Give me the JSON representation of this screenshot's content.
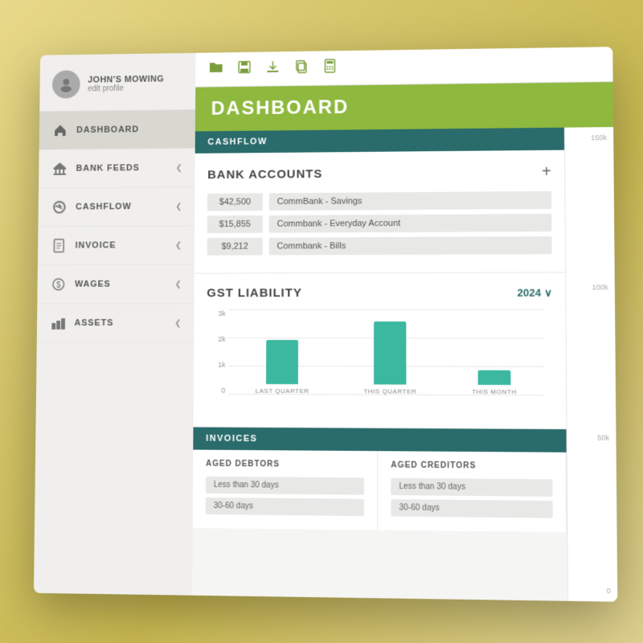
{
  "sidebar": {
    "company": "JOHN'S MOWING",
    "edit_profile": "edit profile",
    "nav_items": [
      {
        "id": "dashboard",
        "label": "DASHBOARD",
        "icon": "🏠",
        "active": true,
        "arrow": ""
      },
      {
        "id": "bank-feeds",
        "label": "BANK FEEDS",
        "icon": "🏛",
        "active": false,
        "arrow": "❮"
      },
      {
        "id": "cashflow",
        "label": "CASHFLOW",
        "icon": "↻",
        "active": false,
        "arrow": "❮"
      },
      {
        "id": "invoice",
        "label": "INVOICE",
        "icon": "📄",
        "active": false,
        "arrow": "❮"
      },
      {
        "id": "wages",
        "label": "WAGES",
        "icon": "💰",
        "active": false,
        "arrow": "❮"
      },
      {
        "id": "assets",
        "label": "ASSETS",
        "icon": "📊",
        "active": false,
        "arrow": "❮"
      }
    ]
  },
  "toolbar": {
    "icons": [
      "📂",
      "💾",
      "📤",
      "📋",
      "🖩"
    ]
  },
  "header": {
    "title": "DASHBOARD"
  },
  "sections": {
    "cashflow_label": "CASHFLOW",
    "invoices_label": "INVOICES"
  },
  "bank_accounts": {
    "title": "BANK ACCOUNTS",
    "add_button": "+",
    "accounts": [
      {
        "amount": "$42,500",
        "name": "CommBank - Savings"
      },
      {
        "amount": "$15,855",
        "name": "Commbank - Everyday Account"
      },
      {
        "amount": "$9,212",
        "name": "Commbank - Bills"
      }
    ]
  },
  "gst_liability": {
    "title": "GST LIABILITY",
    "year": "2024",
    "year_arrow": "∨",
    "y_labels": [
      "3k",
      "2k",
      "1k",
      "0"
    ],
    "bars": [
      {
        "label": "LAST QUARTER",
        "height_pct": 55
      },
      {
        "label": "THIS QUARTER",
        "height_pct": 80
      },
      {
        "label": "THIS MONTH",
        "height_pct": 18
      }
    ]
  },
  "aged_debtors": {
    "title": "AGED DEBTORS",
    "rows": [
      "Less than 30 days",
      "30-60 days"
    ]
  },
  "aged_creditors": {
    "title": "AGED CREDITORS",
    "rows": [
      "Less than 30 days",
      "30-60 days"
    ]
  },
  "cashflow_right": {
    "labels": [
      "150k",
      "100k",
      "50k",
      "0"
    ]
  }
}
